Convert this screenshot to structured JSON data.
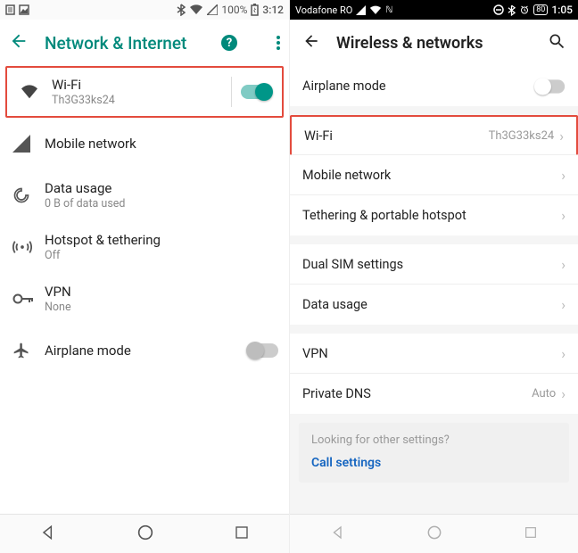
{
  "left": {
    "status": {
      "time": "3:12",
      "battery": "100%"
    },
    "title": "Network & Internet",
    "items": {
      "wifi": {
        "label": "Wi-Fi",
        "sub": "Th3G33ks24",
        "on": true,
        "highlight": true
      },
      "mobile": {
        "label": "Mobile network",
        "sub": ""
      },
      "data": {
        "label": "Data usage",
        "sub": "0 B of data used"
      },
      "hotspot": {
        "label": "Hotspot & tethering",
        "sub": "Off"
      },
      "vpn": {
        "label": "VPN",
        "sub": "None"
      },
      "airplane": {
        "label": "Airplane mode",
        "sub": "",
        "on": false
      }
    }
  },
  "right": {
    "status": {
      "carrier": "Vodafone RO",
      "time": "1:05",
      "battery": "80"
    },
    "title": "Wireless & networks",
    "rows": {
      "airplane": {
        "label": "Airplane mode",
        "on": false
      },
      "wifi": {
        "label": "Wi-Fi",
        "value": "Th3G33ks24",
        "highlight": true
      },
      "mobile": {
        "label": "Mobile network"
      },
      "tether": {
        "label": "Tethering & portable hotspot"
      },
      "dualsim": {
        "label": "Dual SIM settings"
      },
      "data": {
        "label": "Data usage"
      },
      "vpn": {
        "label": "VPN"
      },
      "pdns": {
        "label": "Private DNS",
        "value": "Auto"
      }
    },
    "footer": {
      "muted": "Looking for other settings?",
      "link": "Call settings"
    }
  }
}
